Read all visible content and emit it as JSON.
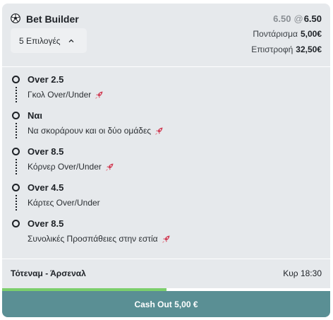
{
  "header": {
    "icon": "soccer-ball-icon",
    "title": "Bet Builder",
    "selections_label": "5 Επιλογές",
    "odds_original": "6.50",
    "odds_at": "@",
    "odds_current": "6.50",
    "stake_label": "Ποντάρισμα",
    "stake_value": "5,00€",
    "return_label": "Επιστροφή",
    "return_value": "32,50€"
  },
  "legs": [
    {
      "pick": "Over 2.5",
      "market": "Γκολ Over/Under",
      "boost": true
    },
    {
      "pick": "Ναι",
      "market": "Να σκοράρουν και οι δύο ομάδες",
      "boost": true
    },
    {
      "pick": "Over 8.5",
      "market": "Κόρνερ Over/Under",
      "boost": true
    },
    {
      "pick": "Over 4.5",
      "market": "Κάρτες Over/Under",
      "boost": false
    },
    {
      "pick": "Over 8.5",
      "market": "Συνολικές Προσπάθειες στην εστία",
      "boost": true
    }
  ],
  "footer": {
    "match": "Τότεναμ - Άρσεναλ",
    "kickoff": "Κυρ 18:30",
    "progress": 0.5,
    "cashout_label": "Cash Out 5,00 €"
  },
  "colors": {
    "card_bg": "#e6e9ec",
    "cashout_bg": "#5a8f94",
    "progress_fill": "#7ccf6c",
    "boost_icon": "#d0435a"
  }
}
